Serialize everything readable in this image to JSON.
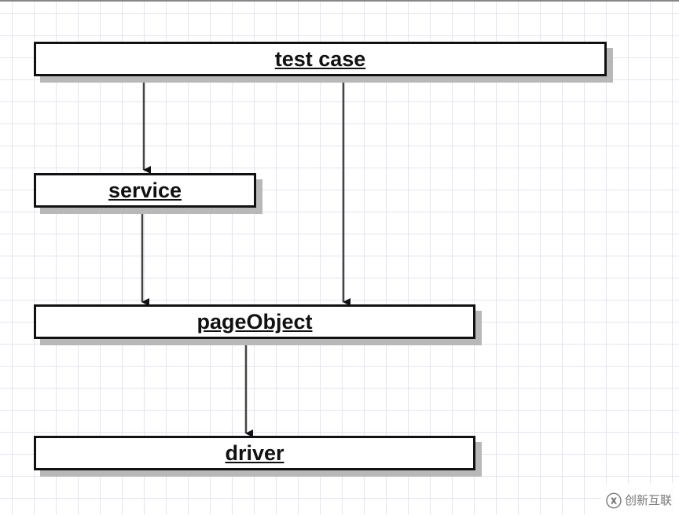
{
  "nodes": {
    "test_case": "test case",
    "service": "service",
    "page_object": "pageObject",
    "driver": "driver"
  },
  "edges": [
    {
      "from": "test case",
      "to": "service"
    },
    {
      "from": "test case",
      "to": "pageObject"
    },
    {
      "from": "service",
      "to": "pageObject"
    },
    {
      "from": "pageObject",
      "to": "driver"
    }
  ],
  "watermark": "创新互联"
}
